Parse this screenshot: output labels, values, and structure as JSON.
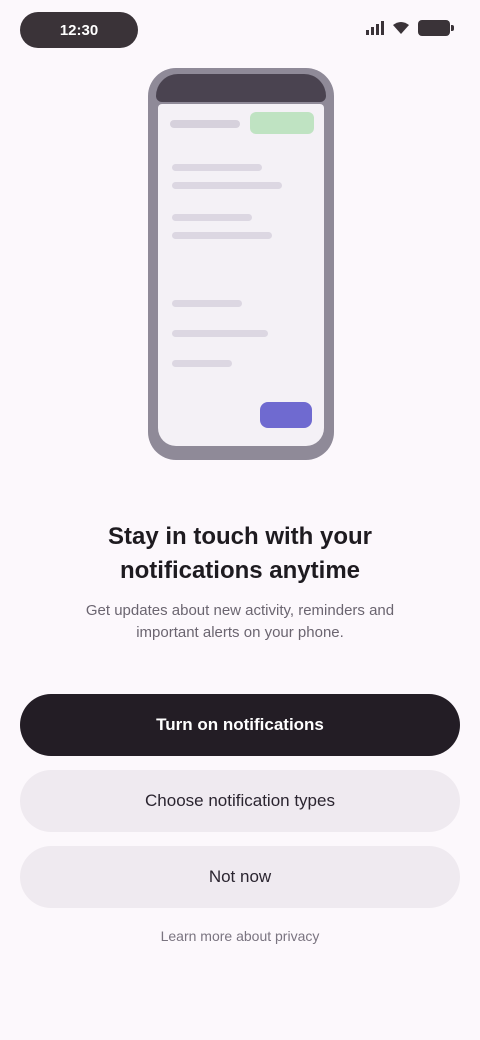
{
  "status_bar": {
    "time": "12:30"
  },
  "illustration": {
    "chip_label": "",
    "fab_label": ""
  },
  "onboarding": {
    "headline": "Stay in touch with your notifications anytime",
    "body": "Get updates about new activity, reminders and important alerts on your phone.",
    "primary_button": "Turn on notifications",
    "secondary_button": "Choose notification types",
    "tertiary_button": "Not now",
    "footer_link": "Learn more about privacy"
  },
  "colors": {
    "primary_button": "#231d25",
    "secondary_button": "#efeaf0",
    "background": "#fcf8fc",
    "accent_chip": "#bfe3c2",
    "accent_fab": "#6f6ad0"
  }
}
